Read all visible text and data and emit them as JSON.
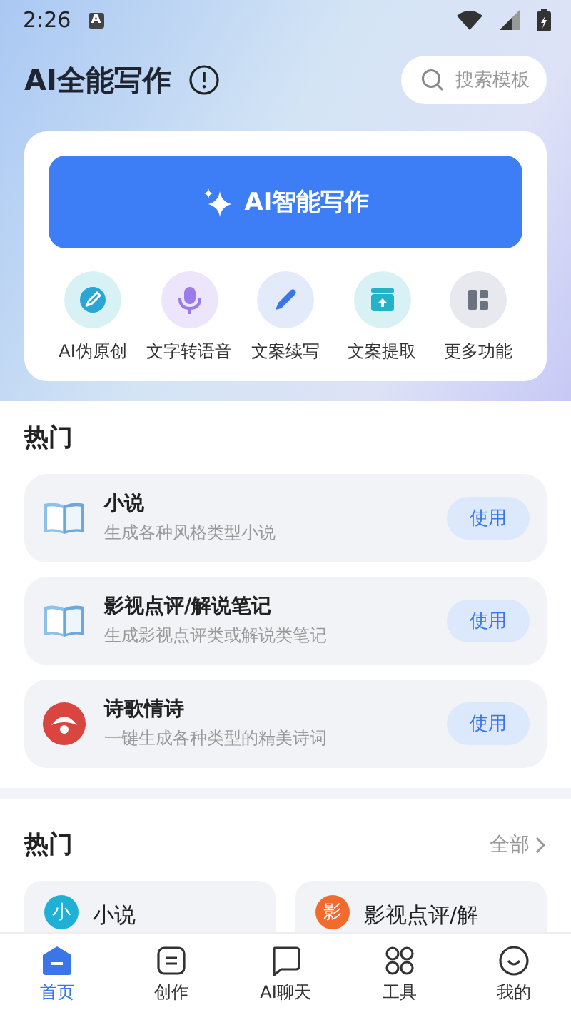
{
  "status_bar": {
    "time": "2:26",
    "badge": "A"
  },
  "header": {
    "title": "AI全能写作",
    "search": {
      "placeholder": "搜索模板"
    }
  },
  "hero": {
    "button": "AI智能写作",
    "tools": [
      {
        "label": "AI伪原创"
      },
      {
        "label": "文字转语音"
      },
      {
        "label": "文案续写"
      },
      {
        "label": "文案提取"
      },
      {
        "label": "更多功能"
      }
    ]
  },
  "hot": {
    "title": "热门",
    "items": [
      {
        "title": "小说",
        "subtitle": "生成各种风格类型小说",
        "action": "使用"
      },
      {
        "title": "影视点评/解说笔记",
        "subtitle": "生成影视点评类或解说类笔记",
        "action": "使用"
      },
      {
        "title": "诗歌情诗",
        "subtitle": "一键生成各种类型的精美诗词",
        "action": "使用"
      }
    ]
  },
  "hot_grid": {
    "title": "热门",
    "more": "全部",
    "cards": [
      {
        "badge": "小",
        "color": "#1fb0d6",
        "title": "小说"
      },
      {
        "badge": "影",
        "color": "#f26b2d",
        "title": "影视点评/解"
      }
    ]
  },
  "nav": [
    {
      "label": "首页",
      "selected": true
    },
    {
      "label": "创作",
      "selected": false
    },
    {
      "label": "AI聊天",
      "selected": false
    },
    {
      "label": "工具",
      "selected": false
    },
    {
      "label": "我的",
      "selected": false
    }
  ]
}
